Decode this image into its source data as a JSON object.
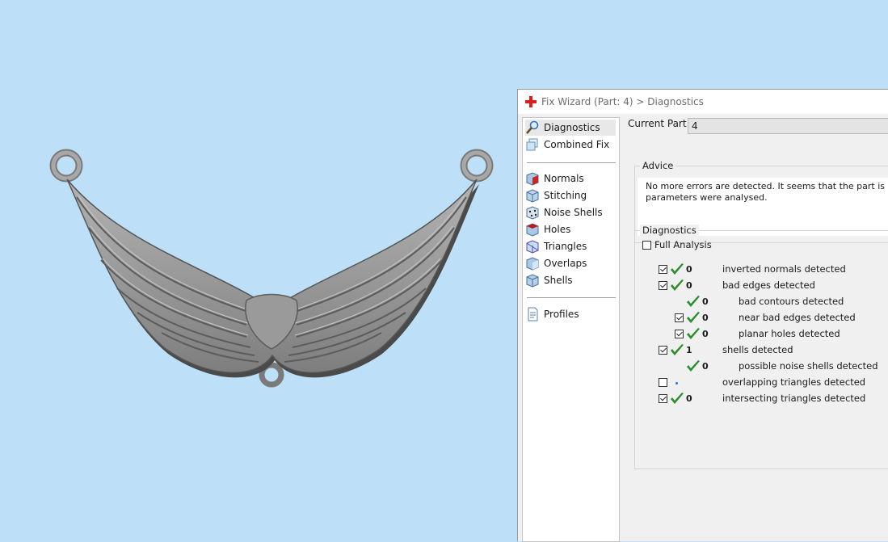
{
  "wizard": {
    "title": "Fix Wizard (Part: 4) > Diagnostics",
    "nav": {
      "diagnostics": "Diagnostics",
      "combined_fix": "Combined Fix",
      "normals": "Normals",
      "stitching": "Stitching",
      "noise_shells": "Noise Shells",
      "holes": "Holes",
      "triangles": "Triangles",
      "overlaps": "Overlaps",
      "shells": "Shells",
      "profiles": "Profiles"
    },
    "current_part_label": "Current Part:",
    "current_part_value": "4",
    "advice": {
      "title": "Advice",
      "text": "No more errors are detected. It seems that the part is ok. No\nparameters were analysed."
    },
    "diagnostics": {
      "title": "Diagnostics",
      "full_analysis_label": "Full Analysis",
      "full_analysis_checked": false,
      "rows": [
        {
          "checked": true,
          "count": "0",
          "label": "inverted normals detected",
          "status": "ok"
        },
        {
          "checked": true,
          "count": "0",
          "label": "bad edges detected",
          "status": "ok"
        },
        {
          "checked": null,
          "count": "0",
          "label": "bad contours detected",
          "status": "ok"
        },
        {
          "checked": true,
          "count": "0",
          "label": "near bad edges detected",
          "status": "ok"
        },
        {
          "checked": true,
          "count": "0",
          "label": "planar holes detected",
          "status": "ok"
        },
        {
          "checked": true,
          "count": "1",
          "label": "shells detected",
          "status": "ok"
        },
        {
          "checked": null,
          "count": "0",
          "label": "possible noise shells detected",
          "status": "ok"
        },
        {
          "checked": false,
          "count": "",
          "label": "overlapping triangles detected",
          "status": "not-run"
        },
        {
          "checked": true,
          "count": "0",
          "label": "intersecting triangles detected",
          "status": "ok"
        }
      ]
    }
  },
  "colors": {
    "background": "#bde0f8",
    "model": "#8c8c8c",
    "check": "#2e8b2e"
  }
}
